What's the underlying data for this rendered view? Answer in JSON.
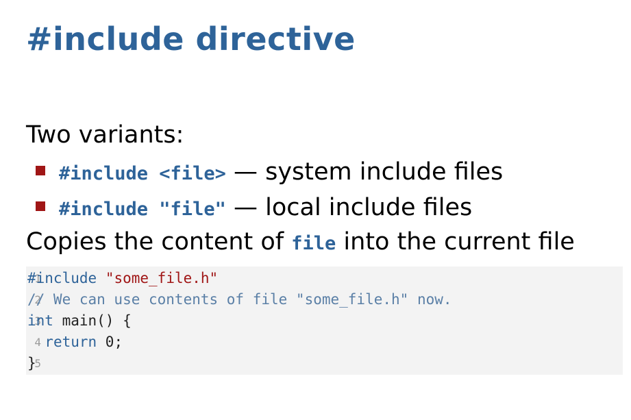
{
  "slide": {
    "title": "#include directive",
    "intro": "Two variants:",
    "bullets": [
      {
        "code": "#include <file>",
        "sep": " — ",
        "text": "system include files"
      },
      {
        "code": "#include \"file\"",
        "sep": " — ",
        "text": "local include files"
      }
    ],
    "copies": {
      "before": "Copies the content of ",
      "code": "file",
      "after": " into the current file"
    }
  },
  "code_block": {
    "line_numbers": [
      "1",
      "2",
      "3",
      "4",
      "5"
    ],
    "lines": [
      {
        "directive": "#include",
        "space": " ",
        "string": "\"some_file.h\""
      },
      {
        "comment": "// We can use contents of file \"some_file.h\" now."
      },
      {
        "keyword": "int",
        "rest": " main() {"
      },
      {
        "indent": "  ",
        "keyword": "return",
        "rest": " 0;"
      },
      {
        "rest": "}"
      }
    ]
  },
  "colors": {
    "accent": "#2e6399",
    "bullet_marker": "#a01616",
    "string": "#a01616",
    "code_background": "#f3f3f3"
  }
}
